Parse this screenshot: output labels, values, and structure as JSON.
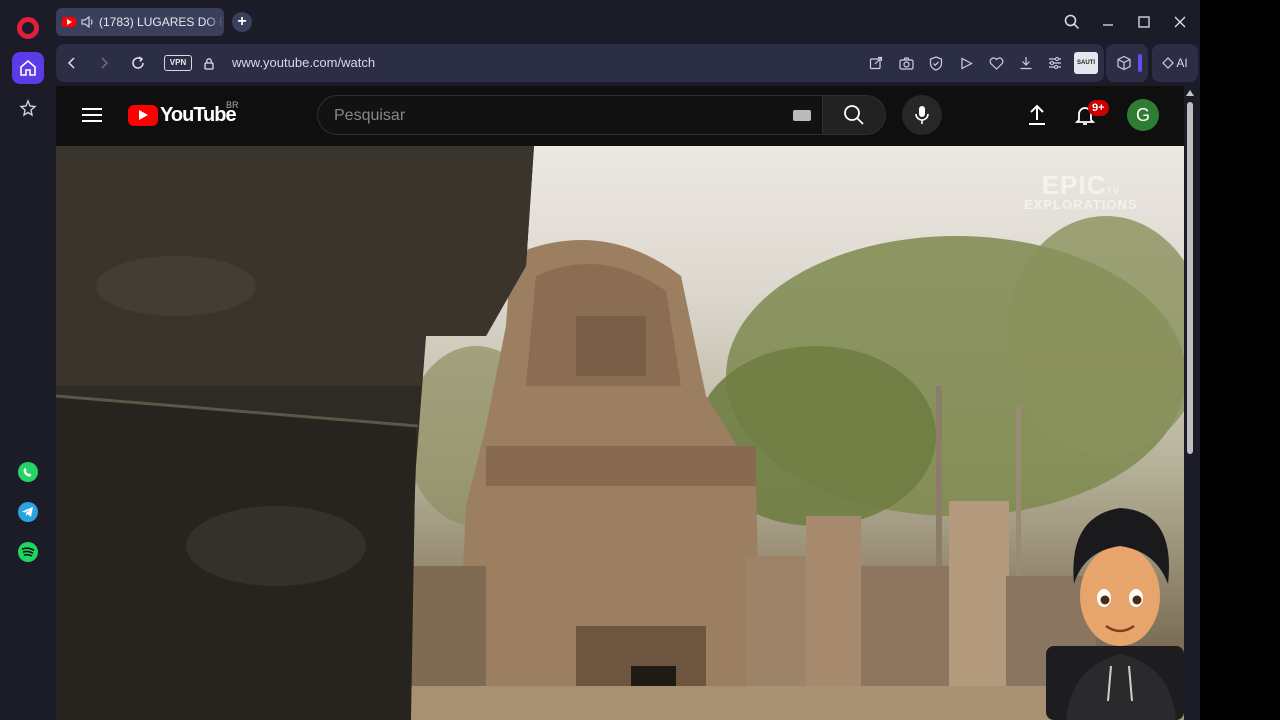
{
  "browser": {
    "tab": {
      "title": "(1783) LUGARES DO P"
    },
    "new_tab_label": "+",
    "address": {
      "vpn_label": "VPN",
      "url": "www.youtube.com/watch"
    },
    "ext_thumb_label": "SAUTI",
    "ai_label": "AI"
  },
  "youtube": {
    "logo_text": "YouTube",
    "country_code": "BR",
    "search": {
      "placeholder": "Pesquisar"
    },
    "notifications_badge": "9+",
    "avatar_letter": "G"
  },
  "video": {
    "watermark_main": "EPIC",
    "watermark_sup": "TV",
    "watermark_sub": "EXPLORATIONS"
  },
  "colors": {
    "opera_red": "#e0203a",
    "sidebar_active": "#5b3ce8",
    "youtube_red": "#ff0000",
    "avatar_bg": "#2e7d32"
  }
}
